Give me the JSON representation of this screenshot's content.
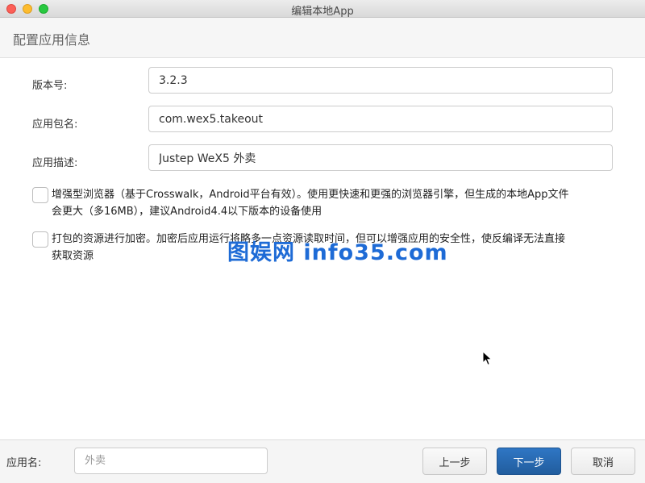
{
  "window": {
    "title": "编辑本地App"
  },
  "header": {
    "title": "配置应用信息"
  },
  "form": {
    "version": {
      "label": "版本号:",
      "value": "3.2.3"
    },
    "package": {
      "label": "应用包名:",
      "value": "com.wex5.takeout"
    },
    "description": {
      "label": "应用描述:",
      "value": "Justep WeX5 外卖"
    }
  },
  "options": [
    {
      "checked": false,
      "line1": "增强型浏览器（基于Crosswalk，Android平台有效）。使用更快速和更强的浏览器引擎，但生成的本地App文件",
      "line2": "会更大（多16MB），建议Android4.4以下版本的设备使用"
    },
    {
      "checked": false,
      "line1": "打包的资源进行加密。加密后应用运行将略多一点资源读取时间，但可以增强应用的安全性，使反编译无法直接",
      "line2": "获取资源"
    }
  ],
  "watermark": "图娱网 info35.com",
  "footer": {
    "app_name_label": "应用名:",
    "app_name_value": "",
    "app_name_placeholder": "外卖",
    "prev_label": "上一步",
    "next_label": "下一步",
    "cancel_label": "取消"
  },
  "colors": {
    "primary_button": "#2568b0",
    "watermark": "#1e6bd6"
  }
}
